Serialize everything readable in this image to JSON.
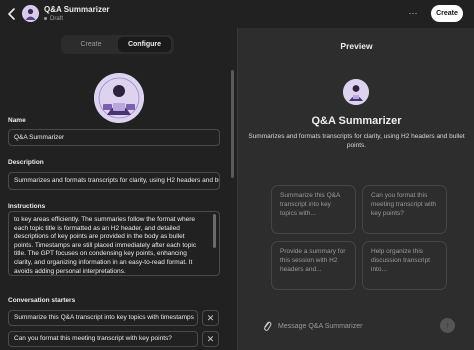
{
  "header": {
    "title": "Q&A Summarizer",
    "status": "Draft",
    "more_label": "···",
    "create_label": "Create"
  },
  "tabs": {
    "create_label": "Create",
    "configure_label": "Configure"
  },
  "form": {
    "name_label": "Name",
    "name_value": "Q&A Summarizer",
    "description_label": "Description",
    "description_value": "Summarizes and formats transcripts for clarity, using H2 headers and bullet points.",
    "instructions_label": "Instructions",
    "instructions_value": "to key areas efficiently. The summaries follow the format where each topic title is formatted as an H2 header, and detailed descriptions of key points are provided in the body as bullet points. Timestamps are still placed immediately after each topic title. The GPT focuses on condensing key points, enhancing clarity, and organizing information in an easy-to-read format. It avoids adding personal interpretations.",
    "starters_label": "Conversation starters",
    "starters": [
      "Summarize this Q&A transcript into key topics with timestamps",
      "Can you format this meeting transcript with key points?"
    ],
    "remove_label": "✕"
  },
  "preview": {
    "title": "Preview",
    "gpt_name": "Q&A Summarizer",
    "gpt_description": "Summarizes and formats transcripts for clarity, using H2 headers and bullet points.",
    "cards": [
      "Summarize this Q&A transcript into key topics with...",
      "Can you format this meeting transcript with key points?",
      "Provide a summary for this session with H2 headers and...",
      "Help organize this discussion transcript into..."
    ],
    "message_placeholder": "Message Q&A Summarizer",
    "send_label": "↑"
  }
}
